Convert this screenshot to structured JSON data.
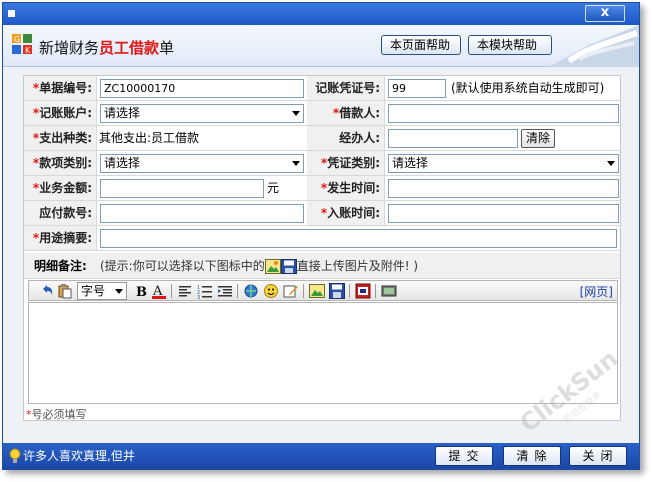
{
  "window": {
    "close_label": "x"
  },
  "header": {
    "title_prefix": "新增财务",
    "title_highlight": "员工借款",
    "title_suffix": "单",
    "help_page": "本页面帮助",
    "help_module": "本模块帮助"
  },
  "form": {
    "required_mark": "*",
    "doc_no": {
      "label": "单据编号:",
      "value": "ZC10000170"
    },
    "voucher_no": {
      "label": "记账凭证号:",
      "value": "99",
      "note": "(默认使用系统自动生成即可)"
    },
    "account": {
      "label": "记账账户:",
      "value": "请选择"
    },
    "borrower": {
      "label": "借款人:",
      "value": ""
    },
    "expense_type": {
      "label": "支出种类:",
      "value": "其他支出:员工借款"
    },
    "handler": {
      "label": "经办人:",
      "value": "",
      "clear_label": "清除"
    },
    "item_type": {
      "label": "款项类别:",
      "value": "请选择"
    },
    "voucher_type": {
      "label": "凭证类别:",
      "value": "请选择"
    },
    "amount": {
      "label": "业务金额:",
      "value": "",
      "unit": "元"
    },
    "occur_time": {
      "label": "发生时间:",
      "value": ""
    },
    "payable_no": {
      "label": "应付款号:",
      "value": ""
    },
    "entry_time": {
      "label": "入账时间:",
      "value": ""
    },
    "purpose": {
      "label": "用途摘要:",
      "value": ""
    },
    "remark": {
      "label": "明细备注:",
      "hint_before": "(提示:你可以选择以下图标中的",
      "hint_after": "直接上传图片及附件! )"
    },
    "toolbar": {
      "font_size": "字号",
      "web_link": "[网页]"
    },
    "required_note_mark": "*",
    "required_note_text": "号必须填写"
  },
  "status": {
    "marquee": "许多人喜欢真理,但并"
  },
  "footer": {
    "submit": "提交",
    "clear": "清除",
    "close": "关闭"
  },
  "watermark": {
    "brand": "ClickSun",
    "sub": "凯信胜技术"
  }
}
